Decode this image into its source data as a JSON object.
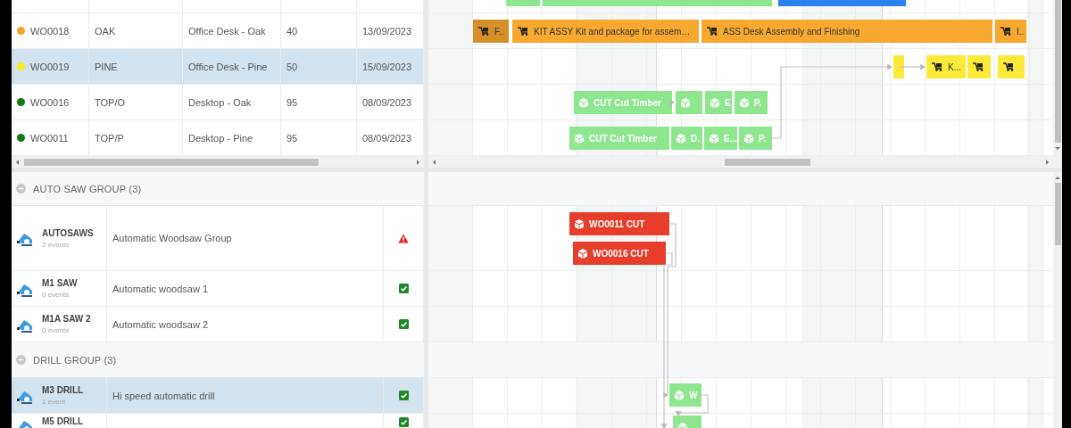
{
  "work_orders": {
    "rows": [
      {
        "id": "WO0018",
        "color": "#f7a12a",
        "code": "OAK",
        "description": "Office Desk - Oak",
        "quantity": "40",
        "date": "13/09/2023",
        "selected": false
      },
      {
        "id": "WO0019",
        "color": "#f5ee1a",
        "code": "PINE",
        "description": "Office Desk - Pine",
        "quantity": "50",
        "date": "15/09/2023",
        "selected": true
      },
      {
        "id": "WO0016",
        "color": "#157a16",
        "code": "TOP/O",
        "description": "Desktop - Oak",
        "quantity": "95",
        "date": "08/09/2023",
        "selected": false
      },
      {
        "id": "WO0011",
        "color": "#157a16",
        "code": "TOP/P",
        "description": "Desktop - Pine",
        "quantity": "95",
        "date": "08/09/2023",
        "selected": false
      }
    ]
  },
  "gantt_top": {
    "rows": [
      {
        "bars": [
          {
            "kind": "plain",
            "color": "#8ee68f"
          },
          {
            "kind": "plain",
            "color": "#8ee68f"
          },
          {
            "kind": "plain",
            "color": "#2d82f2"
          }
        ]
      },
      {
        "bars": [
          {
            "kind": "assembly",
            "color": "#d6902a",
            "label": "F.."
          },
          {
            "kind": "assembly",
            "color": "#f7a82f",
            "label": "KIT ASSY Kit and package for assem…"
          },
          {
            "kind": "assembly",
            "color": "#f7a82f",
            "label": "ASS Desk Assembly and Finishing"
          },
          {
            "kind": "assembly",
            "color": "#f7a82f",
            "label": "I.."
          }
        ]
      },
      {
        "bars": [
          {
            "kind": "plain",
            "color": "#fce93a"
          },
          {
            "kind": "assembly",
            "color": "#fce93a",
            "label": "K..."
          },
          {
            "kind": "assembly",
            "color": "#fce93a"
          },
          {
            "kind": "assembly",
            "color": "#fce93a"
          }
        ]
      },
      {
        "bars": [
          {
            "kind": "cut",
            "color": "#8ee68f",
            "label": "CUT Cut Timber"
          },
          {
            "kind": "cut",
            "color": "#8ee68f"
          },
          {
            "kind": "cut",
            "color": "#8ee68f",
            "label": "E"
          },
          {
            "kind": "cut",
            "color": "#8ee68f",
            "label": "P."
          }
        ]
      },
      {
        "bars": [
          {
            "kind": "cut",
            "color": "#8ee68f",
            "label": "CUT Cut Timber"
          },
          {
            "kind": "cut",
            "color": "#8ee68f",
            "label": "D."
          },
          {
            "kind": "cut",
            "color": "#8ee68f",
            "label": "E..."
          },
          {
            "kind": "cut",
            "color": "#8ee68f",
            "label": "P."
          }
        ]
      }
    ]
  },
  "resources": {
    "groups": [
      {
        "name": "AUTO SAW GROUP (3)",
        "expanded": true,
        "resources": [
          {
            "name": "AUTOSAWS",
            "events": "2 events",
            "description": "Automatic Woodsaw Group",
            "kind": "warning",
            "selected": false
          },
          {
            "name": "M1 SAW",
            "events": "0 events",
            "description": "Automatic woodsaw 1",
            "kind": "ok",
            "selected": false
          },
          {
            "name": "M1A SAW 2",
            "events": "0 events",
            "description": "Automatic woodsaw 2",
            "kind": "ok",
            "selected": false
          }
        ]
      },
      {
        "name": "DRILL GROUP (3)",
        "expanded": true,
        "resources": [
          {
            "name": "M3 DRILL",
            "events": "1 event",
            "description": "Hi speed automatic drill",
            "kind": "ok",
            "selected": true
          },
          {
            "name": "M5 DRILL",
            "kind": "ok",
            "selected": false
          }
        ]
      }
    ]
  },
  "gantt_bottom": {
    "rows": [
      {
        "kind": "group"
      },
      {
        "kind": "resource",
        "bars": [
          {
            "kind": "cut",
            "color": "#e63e2a",
            "label": "WO0011 CUT"
          },
          {
            "kind": "cut",
            "color": "#e63e2a",
            "label": "WO0016 CUT"
          }
        ]
      },
      {
        "kind": "resource"
      },
      {
        "kind": "resource"
      },
      {
        "kind": "group"
      },
      {
        "kind": "resource",
        "bars": [
          {
            "kind": "cut",
            "color": "#8ee68f",
            "label": "W"
          }
        ]
      },
      {
        "kind": "resource",
        "bars": [
          {
            "kind": "cut",
            "color": "#8ee68f"
          }
        ]
      }
    ]
  }
}
